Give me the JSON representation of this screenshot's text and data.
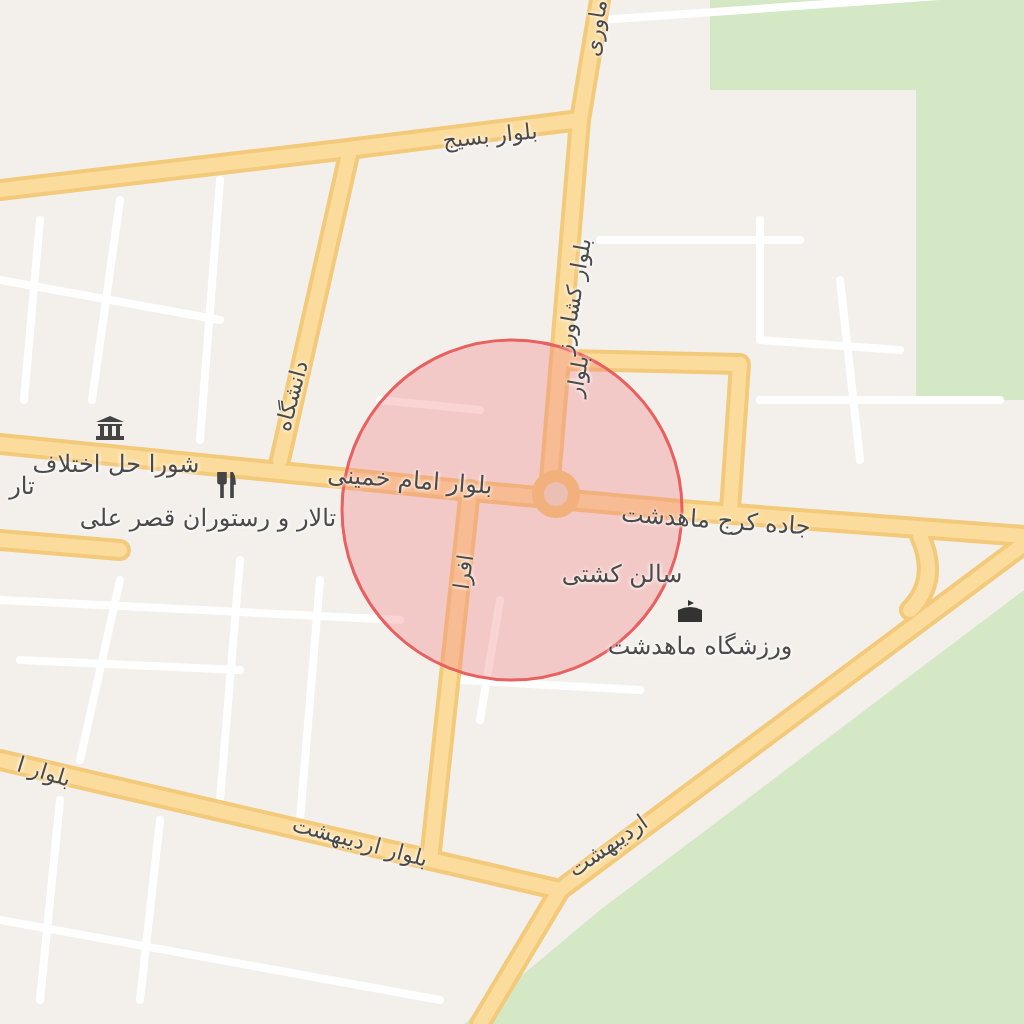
{
  "map": {
    "labels": [
      {
        "text": "ماوری"
      },
      {
        "text": "بلوار بسیج"
      },
      {
        "text": "بلوار کشاورز"
      },
      {
        "text": "بلوار"
      },
      {
        "text": "دانشگاه"
      },
      {
        "text": "شورا حل اختلاف"
      },
      {
        "text": "تار"
      },
      {
        "text": "بلوار امام خمینی"
      },
      {
        "text": "تالار و رستوران قصر علی"
      },
      {
        "text": "جاده کرج ماهدشت"
      },
      {
        "text": "افرا"
      },
      {
        "text": "سالن کشتی"
      },
      {
        "text": "ورزشگاه ماهدشت"
      },
      {
        "text": "بلوار ا"
      },
      {
        "text": "بلوار اردیبهشت"
      },
      {
        "text": "اردیبهشت"
      }
    ]
  }
}
